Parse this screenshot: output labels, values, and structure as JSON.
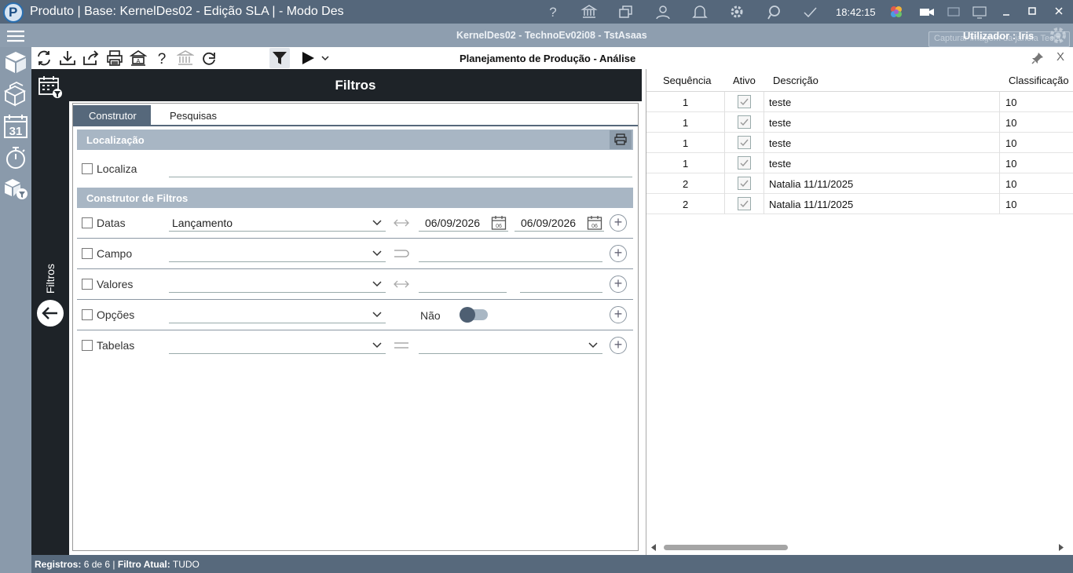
{
  "window": {
    "title": "Produto | Base: KernelDes02 - Edição SLA | - Modo Des",
    "clock": "18:42:15",
    "app_logo_letter": "P"
  },
  "subbar": {
    "server": "KernelDes02 - TechnoEv02i08 - TstAsaas",
    "capture_placeholder": "Capturar imagem da janela Tecla",
    "user_label": "Utilizador : Iris"
  },
  "toolbar": {
    "page_title": "Planejamento de Produção - Análise",
    "close_label": "X"
  },
  "side": {
    "vertical_label": "Filtros"
  },
  "filters": {
    "title": "Filtros",
    "tabs": [
      "Construtor",
      "Pesquisas"
    ],
    "localizacao": {
      "header": "Localização",
      "localiza_label": "Localiza",
      "localiza_value": ""
    },
    "construtor": {
      "header": "Construtor de Filtros",
      "datas": {
        "label": "Datas",
        "field": "Lançamento",
        "from": "06/09/2026",
        "to": "06/09/2026",
        "cal_day": "06"
      },
      "campo": {
        "label": "Campo",
        "field": "",
        "value": ""
      },
      "valores": {
        "label": "Valores",
        "field": "",
        "from": "",
        "to": ""
      },
      "opcoes": {
        "label": "Opções",
        "field": "",
        "toggle_label": "Não",
        "toggle_on": false
      },
      "tabelas": {
        "label": "Tabelas",
        "field": "",
        "value": ""
      }
    }
  },
  "grid": {
    "columns": [
      "Sequência",
      "Ativo",
      "Descrição",
      "Classificação"
    ],
    "rows": [
      {
        "seq": "1",
        "ativo": true,
        "desc": "teste",
        "class": "10"
      },
      {
        "seq": "1",
        "ativo": true,
        "desc": "teste",
        "class": "10"
      },
      {
        "seq": "1",
        "ativo": true,
        "desc": "teste",
        "class": "10"
      },
      {
        "seq": "1",
        "ativo": true,
        "desc": "teste",
        "class": "10"
      },
      {
        "seq": "2",
        "ativo": true,
        "desc": "Natalia 11/11/2025",
        "class": "10"
      },
      {
        "seq": "2",
        "ativo": true,
        "desc": "Natalia 11/11/2025",
        "class": "10"
      }
    ]
  },
  "status": {
    "registros_label": "Registros:",
    "registros_value": "6 de 6",
    "sep": "|",
    "filtro_label": "Filtro Atual:",
    "filtro_value": "TUDO"
  },
  "colors": {
    "titlebar": "#55677b",
    "subbar": "#8e9eaf",
    "dark_panel": "#1e2328",
    "section_header": "#a8b6c4",
    "status_bar": "#57697c"
  }
}
